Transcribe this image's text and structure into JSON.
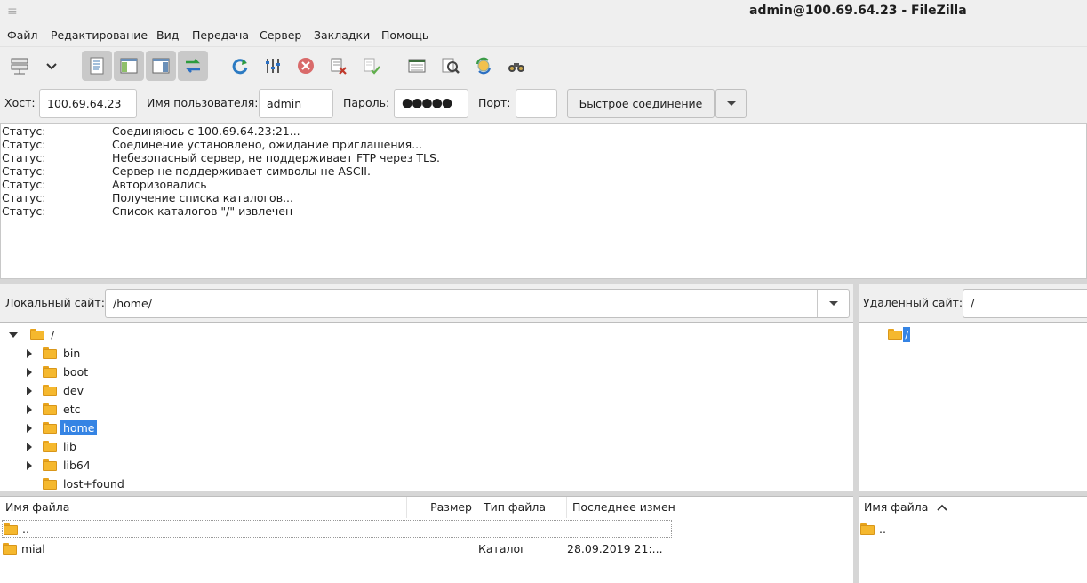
{
  "window": {
    "title": "admin@100.69.64.23 - FileZilla"
  },
  "menu": [
    "Файл",
    "Редактирование",
    "Вид",
    "Передача",
    "Сервер",
    "Закладки",
    "Помощь"
  ],
  "toolbar": {
    "icons": [
      "site-manager-icon",
      "dropdown-arrow-icon",
      "toggle-log-icon",
      "toggle-local-tree-icon",
      "toggle-remote-tree-icon",
      "toggle-transfer-queue-icon",
      "refresh-icon",
      "process-queue-icon",
      "cancel-icon",
      "disconnect-icon",
      "reconnect-icon",
      "directory-listing-filters-icon",
      "compare-directories-icon",
      "synchronized-browsing-icon",
      "search-files-icon"
    ]
  },
  "quickconnect": {
    "host_label": "Хост:",
    "host_value": "100.69.64.23",
    "user_label": "Имя пользователя:",
    "user_value": "admin",
    "pass_label": "Пароль:",
    "pass_value": "●●●●●",
    "port_label": "Порт:",
    "port_value": "",
    "connect_label": "Быстрое соединение"
  },
  "log": [
    {
      "k": "Статус:",
      "v": "Соединяюсь с 100.69.64.23:21..."
    },
    {
      "k": "Статус:",
      "v": "Соединение установлено, ожидание приглашения..."
    },
    {
      "k": "Статус:",
      "v": "Небезопасный сервер, не поддерживает FTP через TLS."
    },
    {
      "k": "Статус:",
      "v": "Сервер не поддерживает символы не ASCII."
    },
    {
      "k": "Статус:",
      "v": "Авторизовались"
    },
    {
      "k": "Статус:",
      "v": "Получение списка каталогов..."
    },
    {
      "k": "Статус:",
      "v": "Список каталогов \"/\" извлечен"
    }
  ],
  "local": {
    "label": "Локальный сайт:",
    "path": "/home/",
    "tree": [
      {
        "name": "/",
        "level": 0,
        "expanded": true
      },
      {
        "name": "bin",
        "level": 1
      },
      {
        "name": "boot",
        "level": 1
      },
      {
        "name": "dev",
        "level": 1
      },
      {
        "name": "etc",
        "level": 1
      },
      {
        "name": "home",
        "level": 1,
        "selected": true
      },
      {
        "name": "lib",
        "level": 1
      },
      {
        "name": "lib64",
        "level": 1
      },
      {
        "name": "lost+found",
        "level": 1,
        "leaf": true
      }
    ],
    "columns": [
      "Имя файла",
      "Размер",
      "Тип файла",
      "Последнее измене"
    ],
    "files": [
      {
        "name": "..",
        "size": "",
        "type": "",
        "modified": ""
      },
      {
        "name": "mial",
        "size": "",
        "type": "Каталог",
        "modified": "28.09.2019 21:..."
      }
    ]
  },
  "remote": {
    "label": "Удаленный сайт:",
    "path": "/",
    "tree": [
      {
        "name": "/",
        "selected": true
      }
    ],
    "columns": [
      "Имя файла"
    ],
    "files": [
      {
        "name": ".."
      }
    ]
  }
}
